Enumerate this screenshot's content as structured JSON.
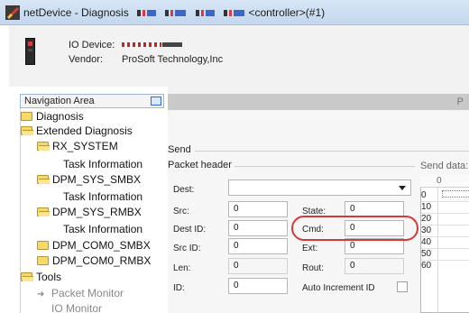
{
  "window": {
    "title": "netDevice - Diagnosis",
    "title_suffix": "<controller>(#1)"
  },
  "device_header": {
    "io_device_label": "IO Device:",
    "vendor_label": "Vendor:",
    "vendor_value": "ProSoft Technology,Inc"
  },
  "nav": {
    "header_label": "Navigation Area",
    "items": [
      {
        "label": "Diagnosis"
      },
      {
        "label": "Extended Diagnosis"
      },
      {
        "label": "RX_SYSTEM"
      },
      {
        "label": "Task Information"
      },
      {
        "label": "DPM_SYS_SMBX"
      },
      {
        "label": "Task Information"
      },
      {
        "label": "DPM_SYS_RMBX"
      },
      {
        "label": "Task Information"
      },
      {
        "label": "DPM_COM0_SMBX"
      },
      {
        "label": "DPM_COM0_RMBX"
      },
      {
        "label": "Tools"
      },
      {
        "label": "Packet Monitor"
      },
      {
        "label": "IO Monitor"
      }
    ]
  },
  "panel": {
    "header_partial": "P",
    "send_group": "Send",
    "packet_header_group": "Packet header",
    "send_data_label": "Send data:",
    "fields": {
      "dest": {
        "label": "Dest:",
        "value": ""
      },
      "src": {
        "label": "Src:",
        "value": "0"
      },
      "dest_id": {
        "label": "Dest ID:",
        "value": "0"
      },
      "src_id": {
        "label": "Src ID:",
        "value": "0"
      },
      "len": {
        "label": "Len:",
        "value": "0"
      },
      "id": {
        "label": "ID:",
        "value": "0"
      },
      "state": {
        "label": "State:",
        "value": "0"
      },
      "cmd": {
        "label": "Cmd:",
        "value": "0"
      },
      "ext": {
        "label": "Ext:",
        "value": "0"
      },
      "rout": {
        "label": "Rout:",
        "value": "0"
      }
    },
    "auto_increment_label": "Auto Increment ID",
    "auto_increment_checked": false
  },
  "send_data_grid": {
    "column_header": "0",
    "row_offsets": [
      "0",
      "10",
      "20",
      "30",
      "40",
      "50",
      "60"
    ]
  },
  "colors": {
    "highlight": "#d43a3a",
    "title_bar": "#c3d7ee",
    "folder": "#f7d86b"
  }
}
